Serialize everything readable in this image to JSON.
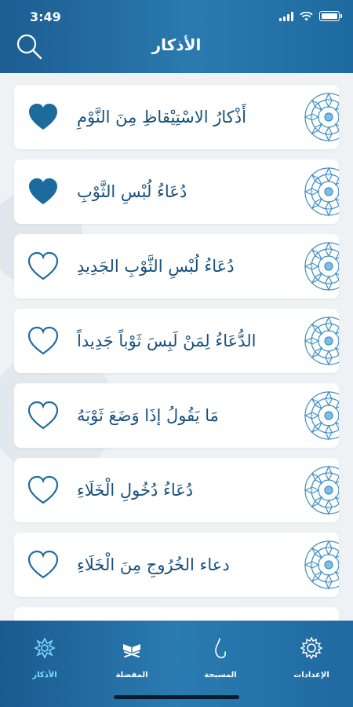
{
  "status_bar": {
    "time": "3:49"
  },
  "header": {
    "title": "الأذكار"
  },
  "items": [
    {
      "text": "أَذْكارُ الاسْتِيْقاظِ مِنَ النَّوْمِ",
      "favorite": true
    },
    {
      "text": "دُعَاءُ لُبْسِ الثَّوْبِ",
      "favorite": true
    },
    {
      "text": "دُعَاءُ لُبْسِ الثَّوْبِ الجَدِيدِ",
      "favorite": false
    },
    {
      "text": "الدُّعَاءُ لِمَنْ لَبِسَ ثَوْباً جَدِيداً",
      "favorite": false
    },
    {
      "text": "مَا يَقُولُ إذَا وَضَعَ ثَوْبَهُ",
      "favorite": false
    },
    {
      "text": "دُعَاءُ دُخُولِ الْخَلَاءِ",
      "favorite": false
    },
    {
      "text": "دعاء الخُرُوجِ مِنَ الْخَلَاءِ",
      "favorite": false
    }
  ],
  "tabs": [
    {
      "label": "الإعدادات",
      "icon": "settings-icon",
      "active": false
    },
    {
      "label": "المسبحة",
      "icon": "prayer-beads-icon",
      "active": false
    },
    {
      "label": "المفضلة",
      "icon": "quran-stand-icon",
      "active": false
    },
    {
      "label": "الأذكار",
      "icon": "ornament-icon",
      "active": true
    }
  ],
  "colors": {
    "header": "#1f6aa0",
    "heart": "#1b6b9c",
    "text": "#17507c",
    "active_tab": "#7fe1ff"
  }
}
